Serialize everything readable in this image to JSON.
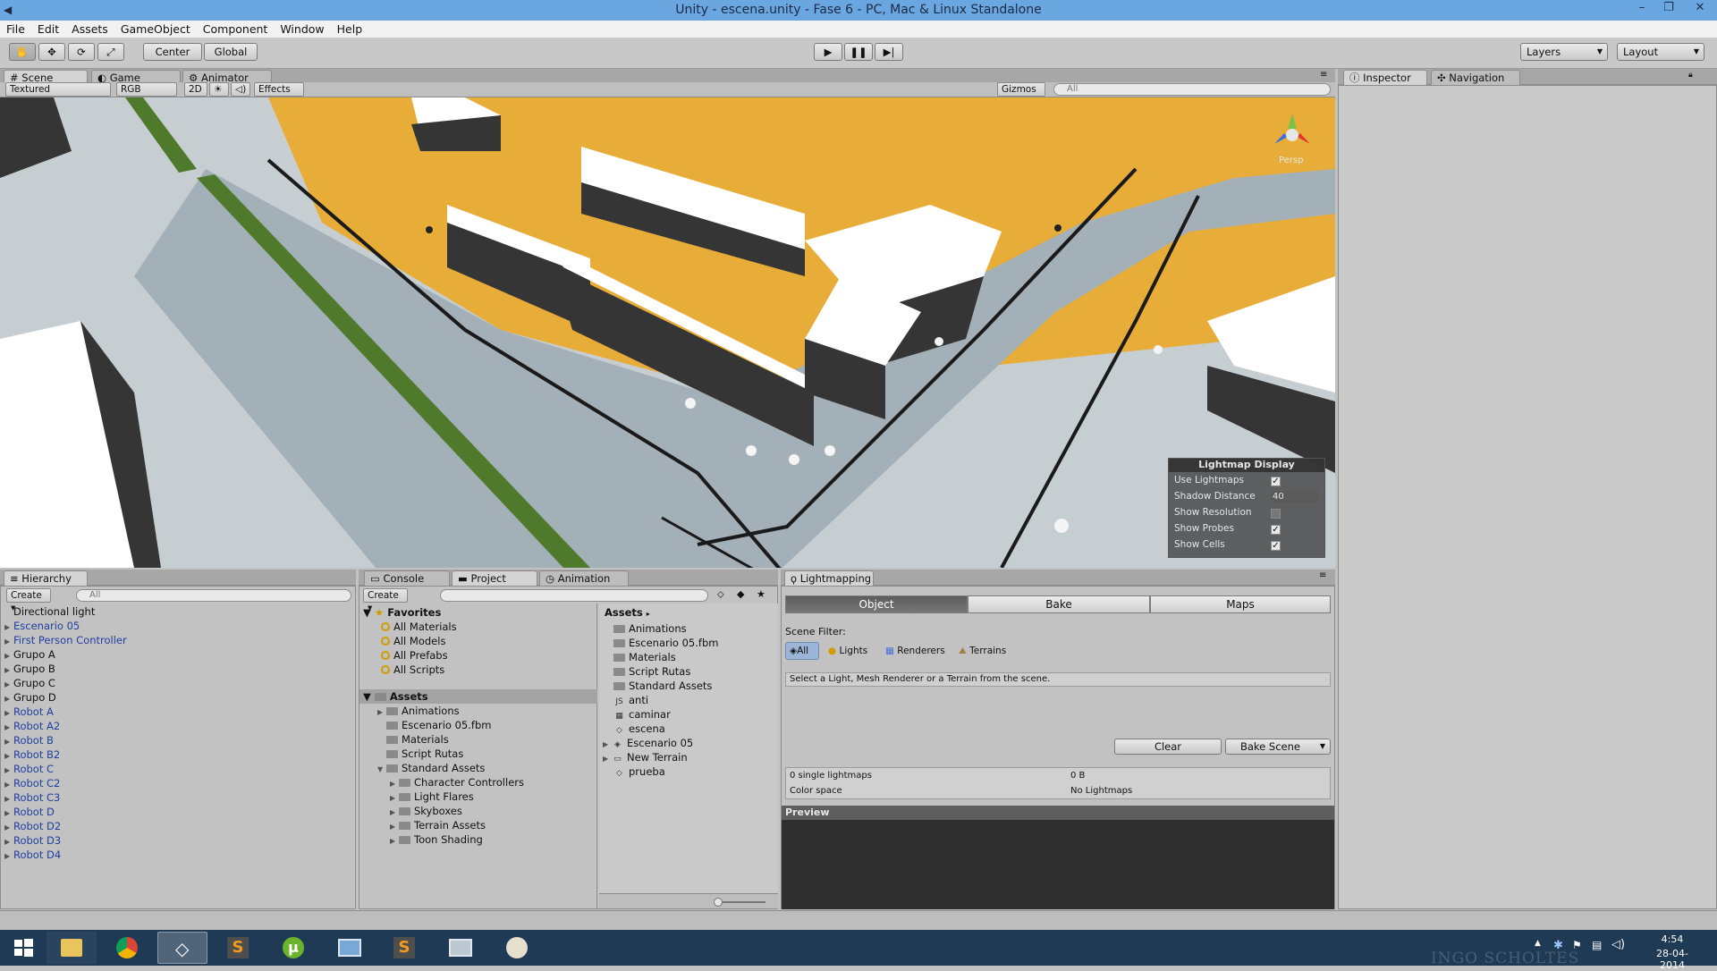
{
  "window": {
    "title": "Unity - escena.unity - Fase 6 - PC, Mac & Linux Standalone"
  },
  "menu": [
    "File",
    "Edit",
    "Assets",
    "GameObject",
    "Component",
    "Window",
    "Help"
  ],
  "toolbar": {
    "tools": [
      "hand-icon",
      "move-icon",
      "rotate-icon",
      "scale-icon"
    ],
    "pivot_center": "Center",
    "pivot_global": "Global",
    "layers": "Layers",
    "layout": "Layout"
  },
  "scene": {
    "tabs": [
      "Scene",
      "Game",
      "Animator"
    ],
    "shading": "Textured",
    "render": "RGB",
    "mode2d": "2D",
    "effects": "Effects",
    "gizmos": "Gizmos",
    "search_placeholder": "All",
    "persp": "Persp"
  },
  "lightmap_display": {
    "title": "Lightmap Display",
    "rows": [
      {
        "label": "Use Lightmaps",
        "checked": true
      },
      {
        "label": "Shadow Distance",
        "value": "40"
      },
      {
        "label": "Show Resolution",
        "checked": false
      },
      {
        "label": "Show Probes",
        "checked": true
      },
      {
        "label": "Show Cells",
        "checked": true
      }
    ]
  },
  "inspector": {
    "tabs": [
      "Inspector",
      "Navigation"
    ]
  },
  "hierarchy": {
    "tab": "Hierarchy",
    "create": "Create",
    "search_placeholder": "All",
    "items": [
      {
        "label": "Directional light",
        "blue": false,
        "arrow": false
      },
      {
        "label": "Escenario 05",
        "blue": true,
        "arrow": true
      },
      {
        "label": "First Person Controller",
        "blue": true,
        "arrow": true
      },
      {
        "label": "Grupo A",
        "blue": false,
        "arrow": true
      },
      {
        "label": "Grupo B",
        "blue": false,
        "arrow": true
      },
      {
        "label": "Grupo C",
        "blue": false,
        "arrow": true
      },
      {
        "label": "Grupo D",
        "blue": false,
        "arrow": true
      },
      {
        "label": "Robot A",
        "blue": true,
        "arrow": true
      },
      {
        "label": "Robot A2",
        "blue": true,
        "arrow": true
      },
      {
        "label": "Robot B",
        "blue": true,
        "arrow": true
      },
      {
        "label": "Robot B2",
        "blue": true,
        "arrow": true
      },
      {
        "label": "Robot C",
        "blue": true,
        "arrow": true
      },
      {
        "label": "Robot C2",
        "blue": true,
        "arrow": true
      },
      {
        "label": "Robot C3",
        "blue": true,
        "arrow": true
      },
      {
        "label": "Robot D",
        "blue": true,
        "arrow": true
      },
      {
        "label": "Robot D2",
        "blue": true,
        "arrow": true
      },
      {
        "label": "Robot D3",
        "blue": true,
        "arrow": true
      },
      {
        "label": "Robot D4",
        "blue": true,
        "arrow": true
      }
    ]
  },
  "project": {
    "tabs": [
      "Console",
      "Project",
      "Animation"
    ],
    "create": "Create",
    "favorites_label": "Favorites",
    "favorites": [
      "All Materials",
      "All Models",
      "All Prefabs",
      "All Scripts"
    ],
    "assets_label": "Assets",
    "tree": [
      {
        "label": "Animations",
        "indent": 1,
        "arrow": true
      },
      {
        "label": "Escenario 05.fbm",
        "indent": 1,
        "arrow": false
      },
      {
        "label": "Materials",
        "indent": 1,
        "arrow": false
      },
      {
        "label": "Script Rutas",
        "indent": 1,
        "arrow": false
      },
      {
        "label": "Standard Assets",
        "indent": 1,
        "arrow": true
      },
      {
        "label": "Character Controllers",
        "indent": 2,
        "arrow": true
      },
      {
        "label": "Light Flares",
        "indent": 2,
        "arrow": true
      },
      {
        "label": "Skyboxes",
        "indent": 2,
        "arrow": true
      },
      {
        "label": "Terrain Assets",
        "indent": 2,
        "arrow": true
      },
      {
        "label": "Toon Shading",
        "indent": 2,
        "arrow": true
      }
    ],
    "breadcrumb": "Assets",
    "files": [
      {
        "label": "Animations",
        "icon": "folder"
      },
      {
        "label": "Escenario 05.fbm",
        "icon": "folder"
      },
      {
        "label": "Materials",
        "icon": "folder"
      },
      {
        "label": "Script Rutas",
        "icon": "folder"
      },
      {
        "label": "Standard Assets",
        "icon": "folder"
      },
      {
        "label": "anti",
        "icon": "script"
      },
      {
        "label": "caminar",
        "icon": "anim"
      },
      {
        "label": "escena",
        "icon": "unity"
      },
      {
        "label": "Escenario 05",
        "icon": "model"
      },
      {
        "label": "New Terrain",
        "icon": "terrain"
      },
      {
        "label": "prueba",
        "icon": "unity"
      }
    ]
  },
  "lightmapping": {
    "tab": "Lightmapping",
    "modes": [
      "Object",
      "Bake",
      "Maps"
    ],
    "scene_filter_label": "Scene Filter:",
    "filters": [
      "All",
      "Lights",
      "Renderers",
      "Terrains"
    ],
    "message": "Select a Light, Mesh Renderer or a Terrain from the scene.",
    "clear": "Clear",
    "bake_scene": "Bake Scene",
    "stats": [
      {
        "label": "0 single lightmaps",
        "value": "0 B"
      },
      {
        "label": "Color space",
        "value": "No Lightmaps"
      }
    ],
    "preview": "Preview"
  },
  "taskbar": {
    "clock_time": "4:54",
    "clock_date": "28-04-2014",
    "watermark": "INGO SCHOLTES"
  },
  "colors": {
    "accent": "#6aa6e0",
    "ground": "#e8ad38",
    "road": "#a3b0b8",
    "building_top": "#ffffff",
    "building_side": "#353535"
  }
}
